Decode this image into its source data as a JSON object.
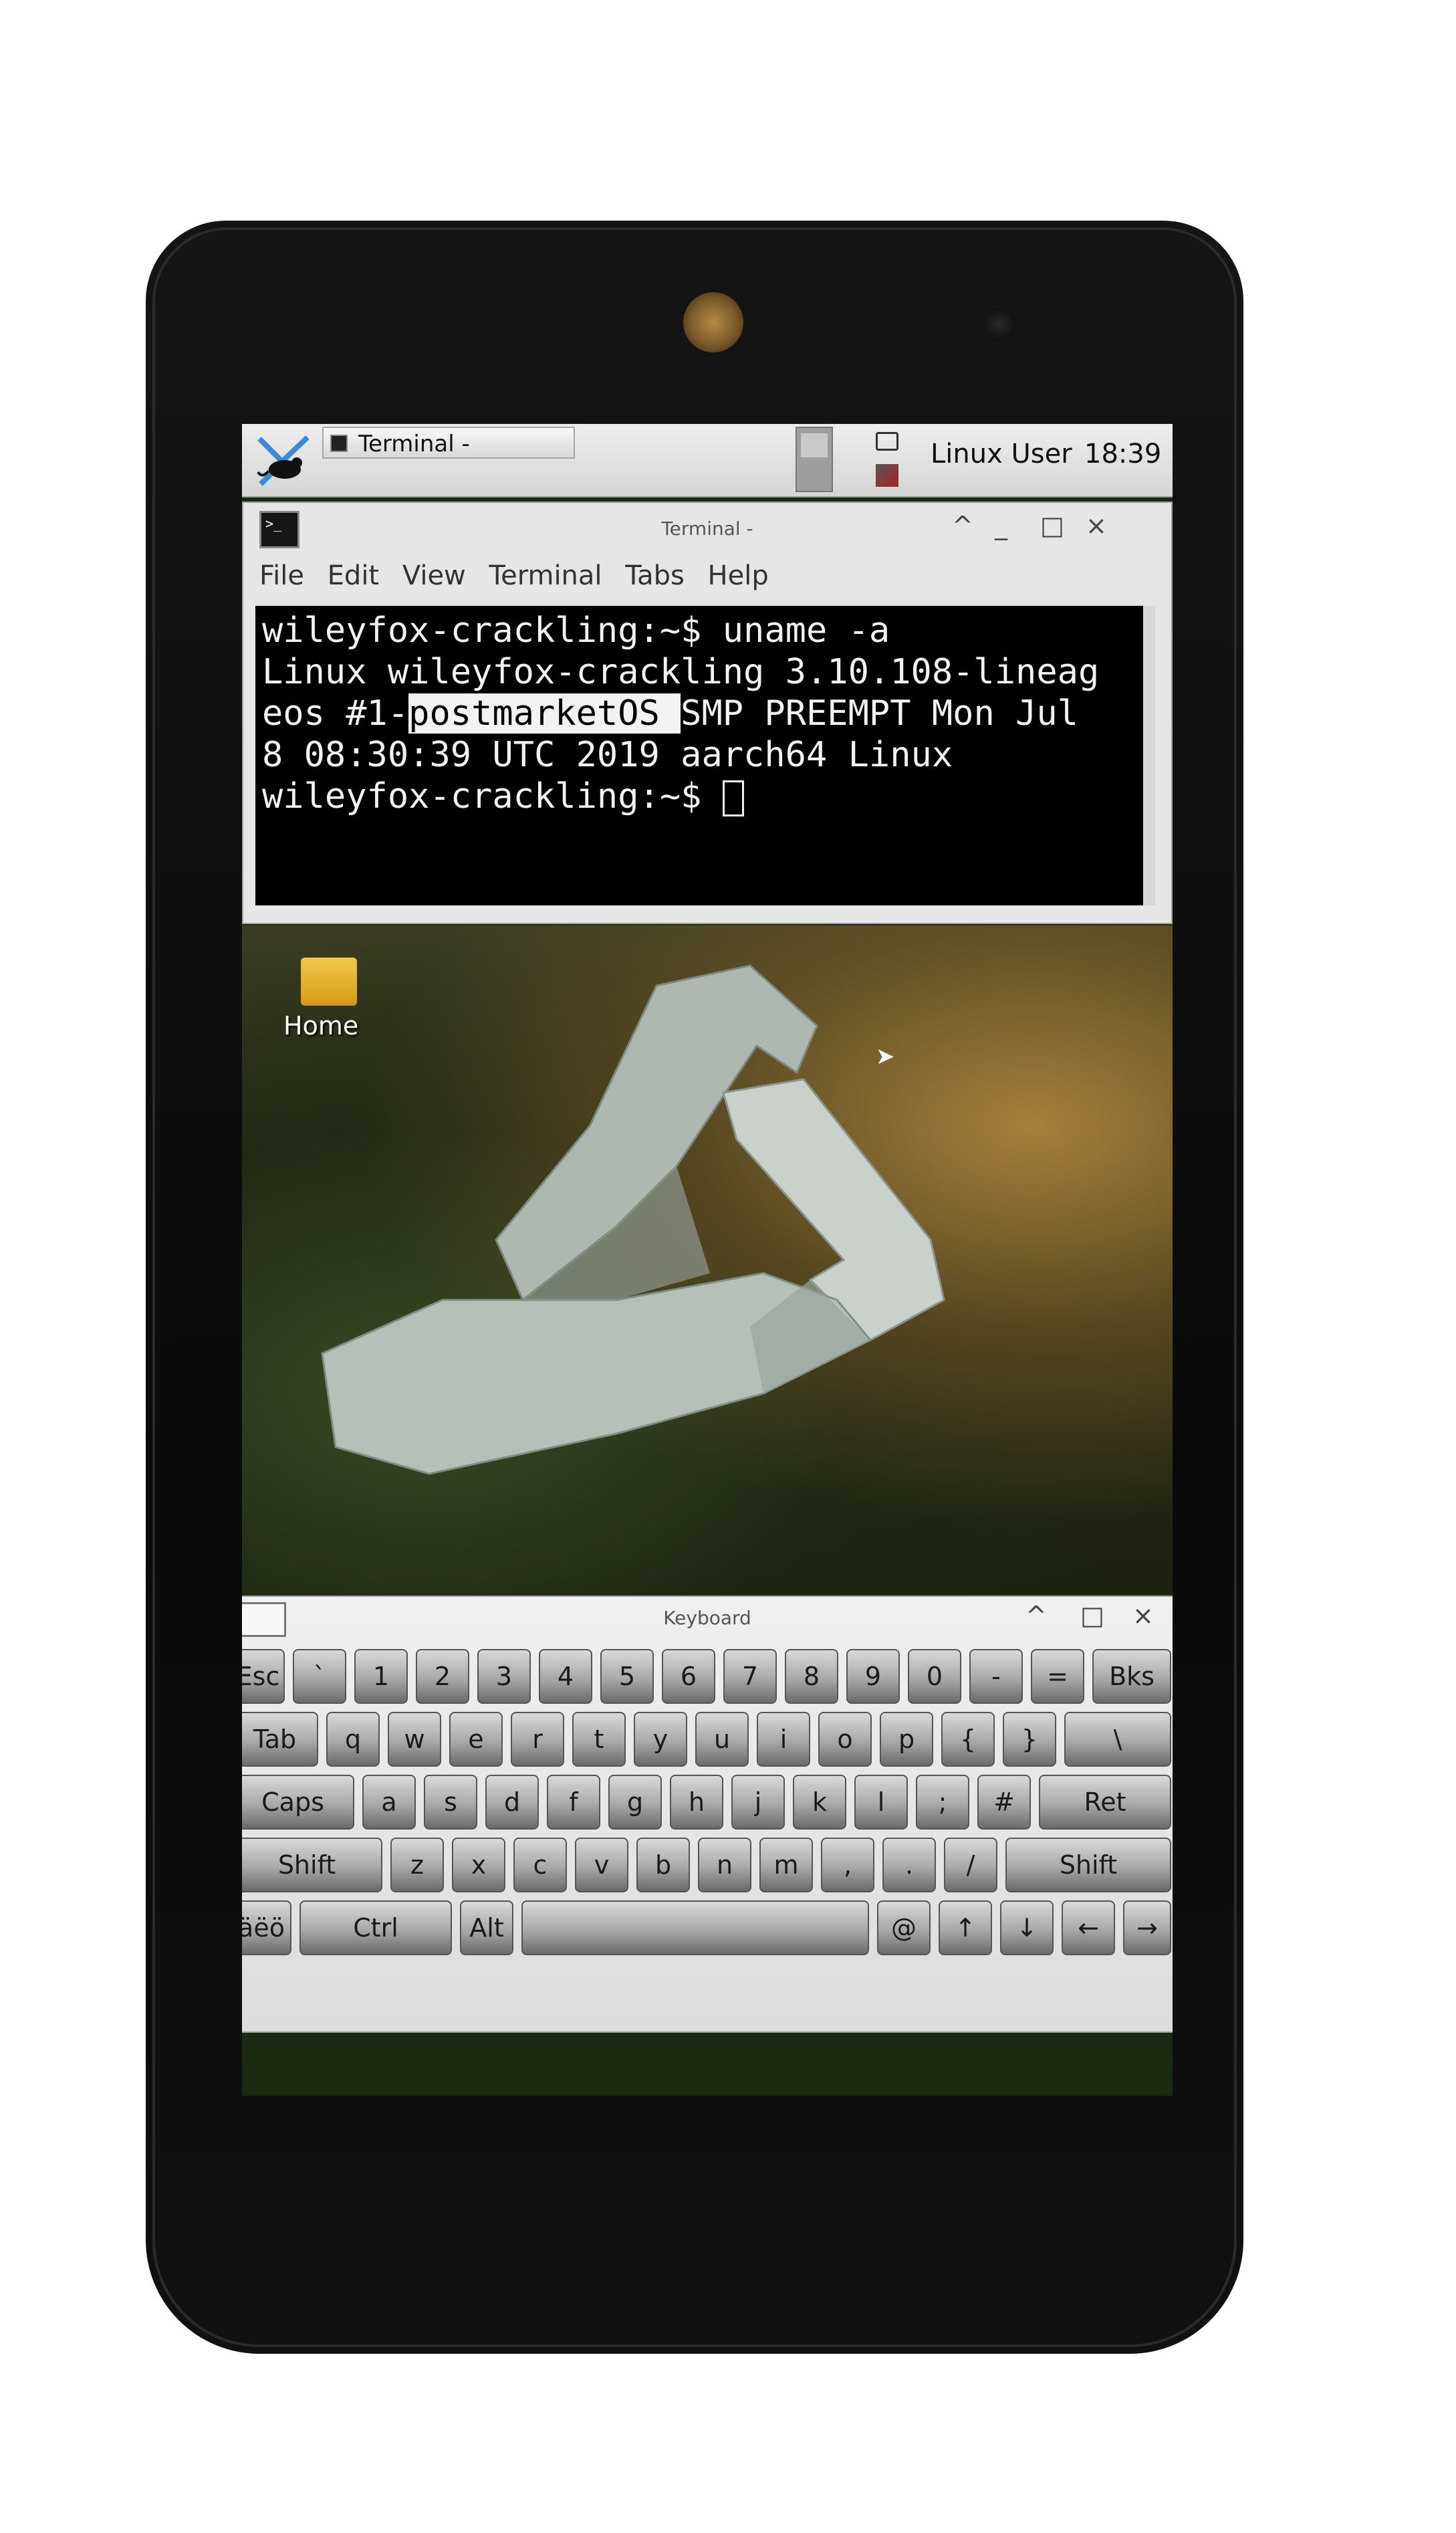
{
  "top_panel": {
    "task_label": "Terminal -",
    "user_label": "Linux User",
    "clock": "18:39"
  },
  "terminal_window": {
    "title": "Terminal -",
    "controls": [
      "^",
      "_",
      "□",
      "×"
    ],
    "menu": [
      "File",
      "Edit",
      "View",
      "Terminal",
      "Tabs",
      "Help"
    ],
    "lines": {
      "l1": "wileyfox-crackling:~$ uname -a",
      "l2": "Linux wileyfox-crackling 3.10.108-lineag",
      "l3a": "eos #1-",
      "l3b": "postmarketOS ",
      "l3c": "SMP PREEMPT Mon Jul",
      "l4": "8 08:30:39 UTC 2019 aarch64 Linux",
      "l5": "wileyfox-crackling:~$ "
    }
  },
  "desktop": {
    "home_label": "Home"
  },
  "keyboard_window": {
    "title": "Keyboard",
    "controls": [
      "^",
      "□",
      "×"
    ],
    "rows": [
      [
        "Esc",
        "`",
        "1",
        "2",
        "3",
        "4",
        "5",
        "6",
        "7",
        "8",
        "9",
        "0",
        "-",
        "=",
        "Bks"
      ],
      [
        "Tab",
        "q",
        "w",
        "e",
        "r",
        "t",
        "y",
        "u",
        "i",
        "o",
        "p",
        "{",
        "}",
        "\\"
      ],
      [
        "Caps",
        "a",
        "s",
        "d",
        "f",
        "g",
        "h",
        "j",
        "k",
        "l",
        ";",
        "#",
        "Ret"
      ],
      [
        "Shift",
        "z",
        "x",
        "c",
        "v",
        "b",
        "n",
        "m",
        ",",
        ".",
        "/",
        "Shift"
      ],
      [
        "äëö",
        "Ctrl",
        "Alt",
        "",
        "@",
        "↑",
        "↓",
        "←",
        "→"
      ]
    ]
  },
  "dock": {
    "items": [
      "show-desktop",
      "terminal",
      "file-manager",
      "web-browser",
      "app-finder",
      "folder",
      "keyboard"
    ]
  }
}
